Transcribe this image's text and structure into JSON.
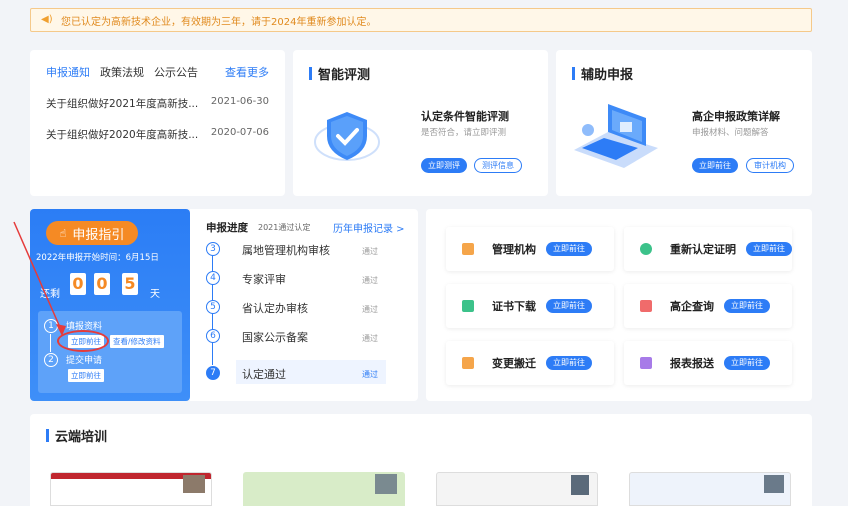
{
  "notice": {
    "text": "您已认定为高新技术企业，有效期为三年，请于2024年重新参加认定。"
  },
  "news": {
    "tabs": [
      "申报通知",
      "政策法规",
      "公示公告"
    ],
    "more": "查看更多",
    "items": [
      {
        "title": "关于组织做好2021年度高新技...",
        "date": "2021-06-30"
      },
      {
        "title": "关于组织做好2020年度高新技...",
        "date": "2020-07-06"
      }
    ]
  },
  "smart": {
    "title": "智能评测",
    "heading": "认定条件智能评测",
    "sub": "是否符合，请立即评测",
    "btn1": "立即测评",
    "btn2": "测评信息"
  },
  "assist": {
    "title": "辅助申报",
    "heading": "高企申报政策详解",
    "sub": "申报材料、问题解答",
    "btn1": "立即前往",
    "btn2": "审计机构"
  },
  "guide": {
    "button": "申报指引",
    "time": "2022年申报开始时间：6月15日",
    "countdown_label": "还剩",
    "digits": [
      "0",
      "0",
      "5"
    ],
    "unit": "天",
    "steps": [
      {
        "num": "1",
        "name": "填报资料",
        "buttons": [
          "立即前往",
          "查看/修改资料"
        ]
      },
      {
        "num": "2",
        "name": "提交申请",
        "buttons": [
          "立即前往"
        ]
      }
    ]
  },
  "progress": {
    "title": "申报进度",
    "sub": "2021通过认定",
    "more": "历年申报记录 >",
    "items": [
      {
        "num": "3",
        "name": "属地管理机构审核",
        "status": "通过"
      },
      {
        "num": "4",
        "name": "专家评审",
        "status": "通过"
      },
      {
        "num": "5",
        "name": "省认定办审核",
        "status": "通过"
      },
      {
        "num": "6",
        "name": "国家公示备案",
        "status": "通过"
      },
      {
        "num": "7",
        "name": "认定通过",
        "status": "通过"
      }
    ]
  },
  "quick": [
    {
      "label": "管理机构",
      "btn": "立即前往",
      "color": "#f5a54a"
    },
    {
      "label": "重新认定证明",
      "btn": "立即前往",
      "color": "#3cc28a"
    },
    {
      "label": "证书下载",
      "btn": "立即前往",
      "color": "#3cc28a"
    },
    {
      "label": "高企查询",
      "btn": "立即前往",
      "color": "#f06b6b"
    },
    {
      "label": "变更搬迁",
      "btn": "立即前往",
      "color": "#f5a54a"
    },
    {
      "label": "报表报送",
      "btn": "立即前往",
      "color": "#a77be8"
    }
  ],
  "training": {
    "title": "云端培训"
  }
}
